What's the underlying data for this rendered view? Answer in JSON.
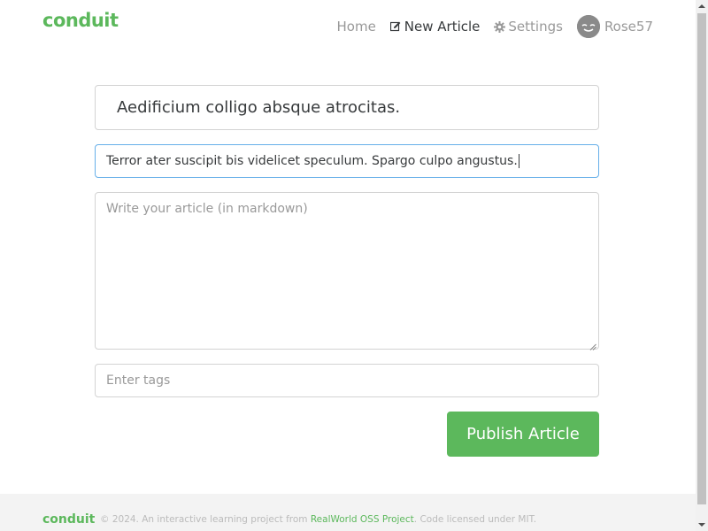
{
  "navbar": {
    "brand": "conduit",
    "items": [
      {
        "label": "Home",
        "icon": null,
        "active": false
      },
      {
        "label": "New Article",
        "icon": "edit-icon",
        "active": true
      },
      {
        "label": "Settings",
        "icon": "gear-icon",
        "active": false
      },
      {
        "label": "Rose57",
        "icon": "avatar",
        "active": false
      }
    ]
  },
  "editor": {
    "title_value": "Aedificium colligo absque atrocitas.",
    "description_value": "Terror ater suscipit bis videlicet speculum. Spargo culpo angustus.",
    "body_placeholder": "Write your article (in markdown)",
    "tags_placeholder": "Enter tags",
    "publish_label": "Publish Article"
  },
  "footer": {
    "brand": "conduit",
    "text_before": "© 2024. An interactive learning project from ",
    "link_text": "RealWorld OSS Project",
    "text_after": ". Code licensed under MIT."
  },
  "colors": {
    "brand": "#5cb85c",
    "nav_inactive": "#999999",
    "nav_active": "#373a3c",
    "focus_border": "#66afe9"
  }
}
